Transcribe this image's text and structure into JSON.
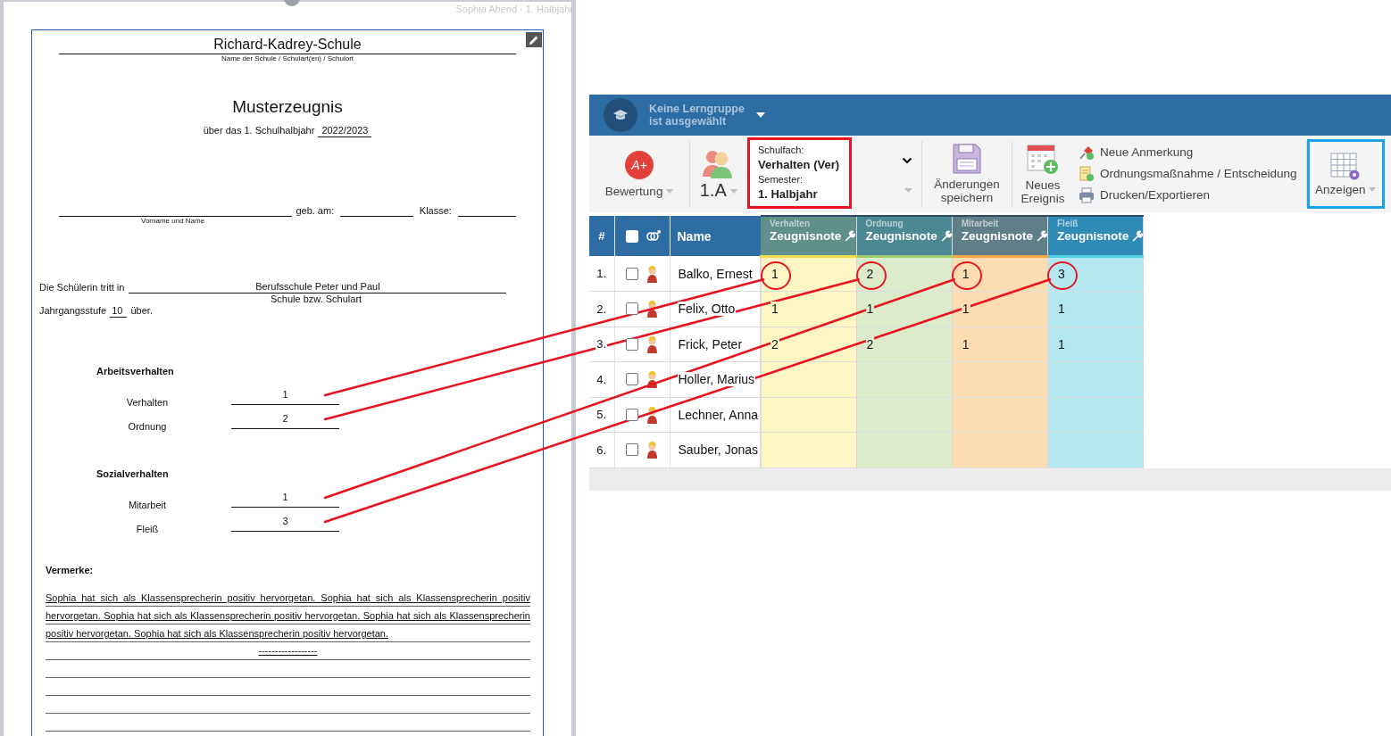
{
  "document": {
    "header_text": "Sophia Abend · 1. Halbjahr",
    "school_name": "Richard-Kadrey-Schule",
    "school_caption": "Name der Schule / Schulart(en) / Schulort",
    "title": "Musterzeugnis",
    "period_label": "über das 1. Schulhalbjahr",
    "school_year": "2022/2023",
    "name_caption": "Vorname und Name",
    "birth_label": "geb. am:",
    "class_label": "Klasse:",
    "transfer_label": "Die Schülerin tritt in",
    "transfer_school": "Berufsschule Peter und Paul",
    "transfer_caption": "Schule bzw. Schulart",
    "level_label": "Jahrgangsstufe",
    "level": "10",
    "level_suffix": "über.",
    "sections": [
      {
        "title": "Arbeitsverhalten",
        "grades": [
          {
            "label": "Verhalten",
            "value": "1"
          },
          {
            "label": "Ordnung",
            "value": "2"
          }
        ]
      },
      {
        "title": "Sozialverhalten",
        "grades": [
          {
            "label": "Mitarbeit",
            "value": "1"
          },
          {
            "label": "Fleiß",
            "value": "3"
          }
        ]
      }
    ],
    "remarks_label": "Vermerke:",
    "remarks": "Sophia hat sich als Klassensprecherin positiv hervorgetan. Sophia hat sich als Klassensprecherin positiv hervorgetan. Sophia hat sich als Klassensprecherin positiv hervorgetan. Sophia hat sich als Klassensprecherin positiv hervorgetan. Sophia hat sich als Klassensprecherin positiv hervorgetan.",
    "separator": "------------------"
  },
  "app": {
    "group_selector": {
      "lines": [
        "Keine Lerngruppe",
        "ist ausgewählt"
      ]
    },
    "toolbar": {
      "grading": {
        "badge": "A+",
        "label": "Bewertung"
      },
      "class": {
        "label": "1.A"
      },
      "subject_selector": {
        "highlighted": true,
        "subject_label": "Schulfach:",
        "subject": "Verhalten (Ver)",
        "semester_label": "Semester:",
        "semester": "1. Halbjahr"
      },
      "save_button": {
        "lines": [
          "Änderungen",
          "speichern"
        ]
      },
      "event_button": {
        "lines": [
          "Neues",
          "Ereignis"
        ]
      },
      "actions": [
        {
          "kind": "pin",
          "label": "Neue Anmerkung"
        },
        {
          "kind": "document",
          "label": "Ordnungsmaßnahme / Entscheidung"
        },
        {
          "kind": "printer",
          "label": "Drucken/Exportieren"
        }
      ],
      "display_button": {
        "highlighted": true,
        "label": "Anzeigen"
      }
    },
    "table": {
      "number_header": "#",
      "select_all_checked": false,
      "name_header": "Name",
      "grade_columns": [
        {
          "subject": "Verhalten",
          "title": "Zeugnisnote",
          "color": "#fdf6c4"
        },
        {
          "subject": "Ordnung",
          "title": "Zeugnisnote",
          "color": "#dcebc9"
        },
        {
          "subject": "Mitarbeit",
          "title": "Zeugnisnote",
          "color": "#fddcb1"
        },
        {
          "subject": "Fleiß",
          "title": "Zeugnisnote",
          "color": "#b4e8f1"
        }
      ],
      "rows": [
        {
          "number": "1.",
          "checked": false,
          "name": "Balko, Ernest",
          "grades": [
            {
              "value": "1",
              "circled": true
            },
            {
              "value": "2",
              "circled": true
            },
            {
              "value": "1",
              "circled": true
            },
            {
              "value": "3",
              "circled": true
            }
          ]
        },
        {
          "number": "2.",
          "checked": false,
          "name": "Felix, Otto",
          "grades": [
            {
              "value": "1",
              "circled": false
            },
            {
              "value": "1",
              "circled": false
            },
            {
              "value": "1",
              "circled": false
            },
            {
              "value": "1",
              "circled": false
            }
          ]
        },
        {
          "number": "3.",
          "checked": false,
          "name": "Frick, Peter",
          "grades": [
            {
              "value": "2",
              "circled": false
            },
            {
              "value": "2",
              "circled": false
            },
            {
              "value": "1",
              "circled": false
            },
            {
              "value": "1",
              "circled": false
            }
          ]
        },
        {
          "number": "4.",
          "checked": false,
          "name": "Holler, Marius"
        },
        {
          "number": "5.",
          "checked": false,
          "name": "Lechner, Anna"
        },
        {
          "number": "6.",
          "checked": false,
          "name": "Sauber, Jonas"
        }
      ]
    }
  }
}
